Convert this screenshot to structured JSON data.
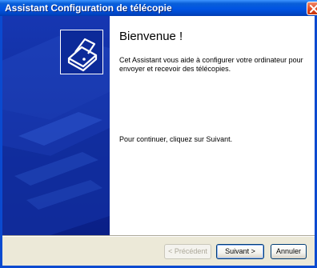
{
  "window": {
    "title": "Assistant Configuration de télécopie"
  },
  "content": {
    "heading": "Bienvenue !",
    "intro": "Cet Assistant vous aide à configurer votre ordinateur pour envoyer et recevoir des télécopies.",
    "continue_text": "Pour continuer, cliquez sur Suivant."
  },
  "buttons": {
    "prev": "< Précédent",
    "next": "Suivant >",
    "cancel": "Annuler"
  },
  "colors": {
    "side_panel": "#0c2a99",
    "titlebar": "#0054e3",
    "close_button": "#e24a20"
  },
  "icons": {
    "wizard": "fax-machine-icon",
    "close": "close-icon"
  }
}
